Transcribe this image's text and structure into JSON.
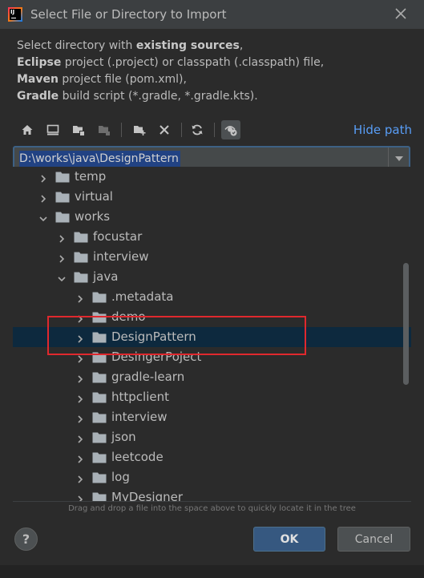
{
  "window": {
    "title": "Select File or Directory to Import",
    "logo_text": "IJ"
  },
  "description": {
    "line1_prefix": "Select directory with ",
    "line1_bold": "existing sources",
    "line1_suffix": ",",
    "line2_bold": "Eclipse",
    "line2_rest": " project (.project) or classpath (.classpath) file,",
    "line3_bold": "Maven",
    "line3_rest": " project file (pom.xml),",
    "line4_bold": "Gradle",
    "line4_rest": " build script (*.gradle, *.gradle.kts)."
  },
  "toolbar": {
    "icons": [
      "home-icon",
      "desktop-icon",
      "project-folder-icon",
      "module-folder-icon",
      "new-folder-icon",
      "delete-icon",
      "refresh-icon",
      "show-hidden-icon"
    ],
    "hide_path_label": "Hide path"
  },
  "path": {
    "value": "D:\\works\\java\\DesignPattern"
  },
  "tree": {
    "items": [
      {
        "label": "temp",
        "level": 0,
        "expanded": false,
        "selected": false
      },
      {
        "label": "virtual",
        "level": 0,
        "expanded": false,
        "selected": false
      },
      {
        "label": "works",
        "level": 0,
        "expanded": true,
        "selected": false
      },
      {
        "label": "focustar",
        "level": 1,
        "expanded": false,
        "selected": false
      },
      {
        "label": "interview",
        "level": 1,
        "expanded": false,
        "selected": false
      },
      {
        "label": "java",
        "level": 1,
        "expanded": true,
        "selected": false
      },
      {
        "label": ".metadata",
        "level": 2,
        "expanded": false,
        "selected": false
      },
      {
        "label": "demo",
        "level": 2,
        "expanded": false,
        "selected": false
      },
      {
        "label": "DesignPattern",
        "level": 2,
        "expanded": false,
        "selected": true
      },
      {
        "label": "DesingerPoject",
        "level": 2,
        "expanded": false,
        "selected": false
      },
      {
        "label": "gradle-learn",
        "level": 2,
        "expanded": false,
        "selected": false
      },
      {
        "label": "httpclient",
        "level": 2,
        "expanded": false,
        "selected": false
      },
      {
        "label": "interview",
        "level": 2,
        "expanded": false,
        "selected": false
      },
      {
        "label": "json",
        "level": 2,
        "expanded": false,
        "selected": false
      },
      {
        "label": "leetcode",
        "level": 2,
        "expanded": false,
        "selected": false
      },
      {
        "label": "log",
        "level": 2,
        "expanded": false,
        "selected": false
      },
      {
        "label": "MyDesigner",
        "level": 2,
        "expanded": false,
        "selected": false
      }
    ]
  },
  "hint": "Drag and drop a file into the space above to quickly locate it in the tree",
  "buttons": {
    "help": "?",
    "ok": "OK",
    "cancel": "Cancel"
  },
  "colors": {
    "background": "#2b2b2b",
    "selection": "#0d293e",
    "link": "#589df6",
    "highlight_annotation": "#e0282e",
    "ok_button": "#365880"
  }
}
